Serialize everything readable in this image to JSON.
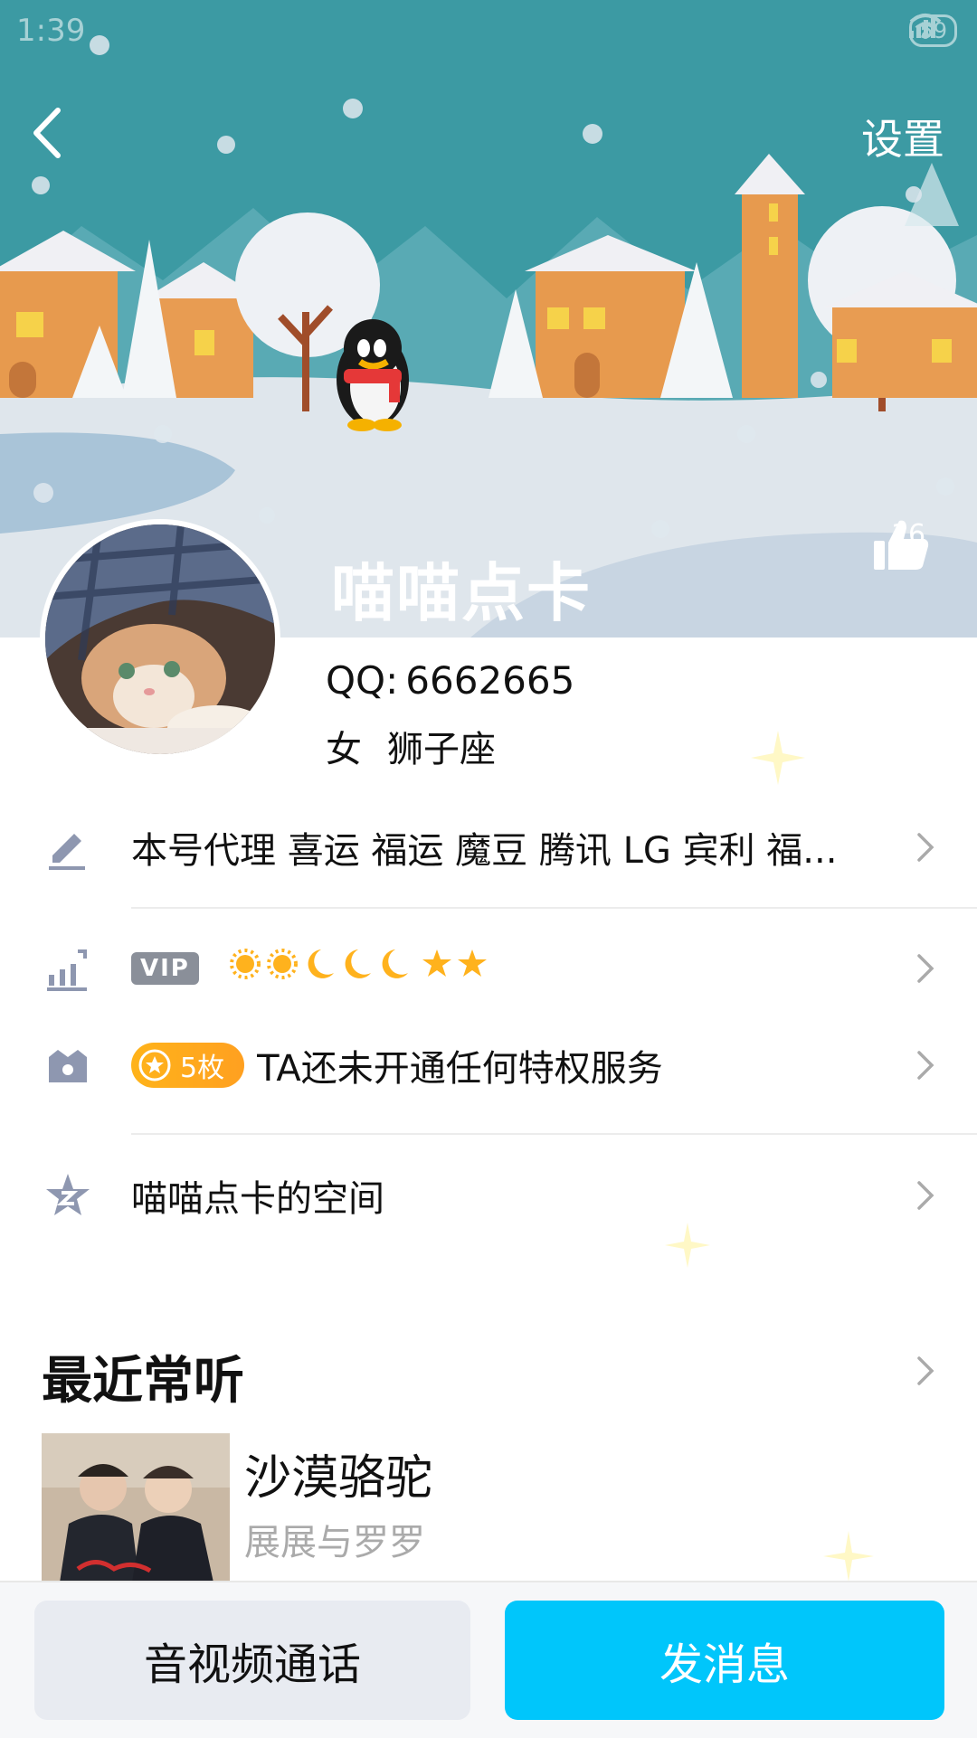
{
  "status_bar": {
    "time": "1:39",
    "battery": "59"
  },
  "header": {
    "settings_label": "设置"
  },
  "profile": {
    "nickname": "喵喵点卡",
    "like_count": "16",
    "qq_label": "QQ:",
    "qq_number": "6662665",
    "gender": "女",
    "constellation": "狮子座"
  },
  "rows": {
    "signature": "本号代理 喜运 福运  魔豆 腾讯 LG  宾利  福...",
    "vip_badge": "VIP",
    "vip_level_icons": [
      "sun-icon",
      "sun-icon",
      "moon-icon",
      "moon-icon",
      "moon-icon",
      "star-icon",
      "star-icon"
    ],
    "coin_count": "5枚",
    "privilege_text": "TA还未开通任何特权服务",
    "space_label": "喵喵点卡的空间"
  },
  "recent": {
    "title": "最近常听",
    "song_title": "沙漠骆驼",
    "song_artist": "展展与罗罗"
  },
  "bottom_bar": {
    "call_label": "音视频通话",
    "message_label": "发消息"
  },
  "colors": {
    "accent": "#00c6fb",
    "sky": "#3e9fa6",
    "coin_gold": "#ffa820",
    "icon_gray": "#8e97b0"
  }
}
